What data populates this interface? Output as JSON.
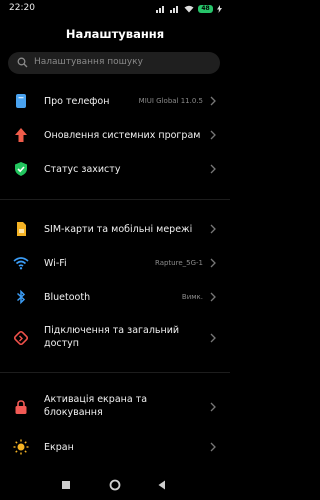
{
  "status_bar": {
    "time": "22:20",
    "battery": "48"
  },
  "header": {
    "title": "Налаштування"
  },
  "search": {
    "placeholder": "Налаштування пошуку"
  },
  "sections": [
    {
      "items": [
        {
          "label": "Про телефон",
          "value": "MIUI Global 11.0.5",
          "icon": "phone-info-icon",
          "color": "#4aa3f0"
        },
        {
          "label": "Оновлення системних програм",
          "value": "",
          "icon": "update-arrow-icon",
          "color": "#f05c4a"
        },
        {
          "label": "Статус захисту",
          "value": "",
          "icon": "shield-check-icon",
          "color": "#22c55e"
        }
      ]
    },
    {
      "items": [
        {
          "label": "SIM-карти та мобільні мережі",
          "value": "",
          "icon": "sim-card-icon",
          "color": "#f5b324"
        },
        {
          "label": "Wi-Fi",
          "value": "Rapture_5G-1",
          "icon": "wifi-icon",
          "color": "#3b9cf5"
        },
        {
          "label": "Bluetooth",
          "value": "Вимк.",
          "icon": "bluetooth-icon",
          "color": "#3b9cf5"
        },
        {
          "label": "Підключення та загальний доступ",
          "value": "",
          "icon": "connection-share-icon",
          "color": "#f0514a"
        }
      ]
    },
    {
      "items": [
        {
          "label": "Активація екрана та блокування",
          "value": "",
          "icon": "lock-icon",
          "color": "#f25a55"
        },
        {
          "label": "Екран",
          "value": "",
          "icon": "brightness-icon",
          "color": "#f5b324"
        }
      ]
    }
  ]
}
